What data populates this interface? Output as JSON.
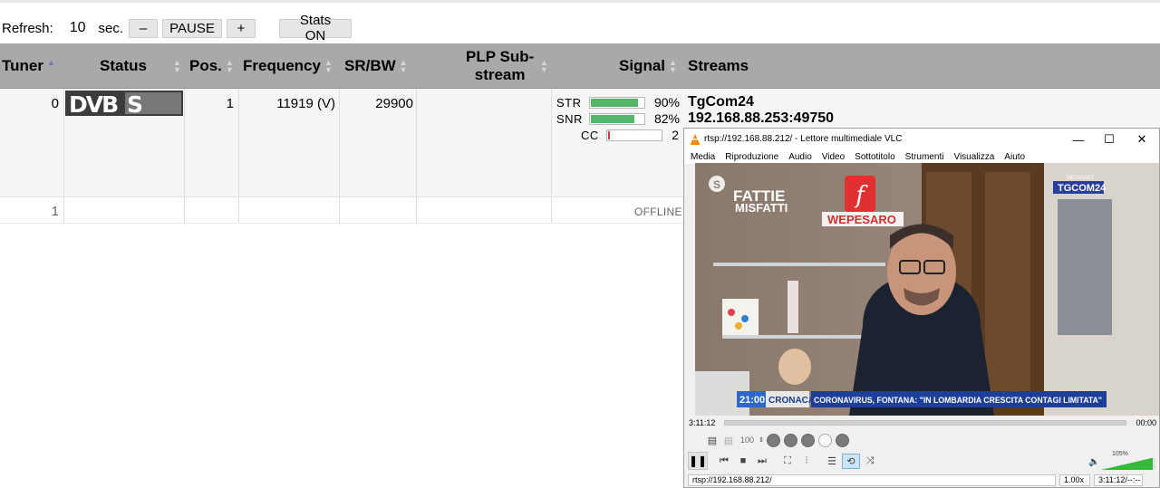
{
  "controls": {
    "refresh_label": "Refresh:",
    "refresh_value": "10",
    "refresh_unit": "sec.",
    "minus_label": "–",
    "pause_label": "PAUSE",
    "plus_label": "+",
    "stats_label": "Stats ON"
  },
  "table": {
    "headers": {
      "tuner": "Tuner",
      "status": "Status",
      "pos": "Pos.",
      "frequency": "Frequency",
      "srbw": "SR/BW",
      "plp_line1": "PLP Sub-",
      "plp_line2": "stream",
      "signal": "Signal",
      "streams": "Streams"
    },
    "rows": [
      {
        "tuner": "0",
        "status_logo": "DVB-S",
        "pos": "1",
        "frequency": "11919 (V)",
        "srbw": "29900",
        "signal": {
          "str_label": "STR",
          "str_value": "90%",
          "str_level": 0.9,
          "snr_label": "SNR",
          "snr_value": "82%",
          "snr_level": 0.82,
          "cc_label": "CC",
          "cc_value": "2"
        },
        "stream_name": "TgCom24",
        "stream_addr": "192.168.88.253:49750"
      },
      {
        "tuner": "1",
        "status_text": "OFFLINE"
      }
    ]
  },
  "vlc": {
    "title": "rtsp://192.168.88.212/ - Lettore multimediale VLC",
    "menu": [
      "Media",
      "Riproduzione",
      "Audio",
      "Video",
      "Sottotitolo",
      "Strumenti",
      "Visualizza",
      "Aiuto"
    ],
    "elapsed": "3:11:12",
    "remaining": "00:00",
    "speed_box": "100",
    "volume": "105%",
    "volume_level": 1.05,
    "status_url": "rtsp://192.168.88.212/",
    "status_rate": "1.00x",
    "status_time": "3:11:12/--:--",
    "video": {
      "program_line1": "FATTIE",
      "program_line2": "MISFATTI",
      "sign_text": "WEPESARO",
      "channel_small": "MEDIASET",
      "channel_logo": "TGCOM24",
      "ticker_time": "21:00",
      "ticker_section": "CRONACA",
      "ticker_headline": "CORONAVIRUS, FONTANA: \"IN LOMBARDIA CRESCITA CONTAGI LIMITATA\""
    }
  },
  "colors": {
    "header_bg": "#a9a9a9",
    "bar_green": "#53b66b",
    "bar_red": "#d43b3b",
    "sort_active": "#6a78c8"
  }
}
